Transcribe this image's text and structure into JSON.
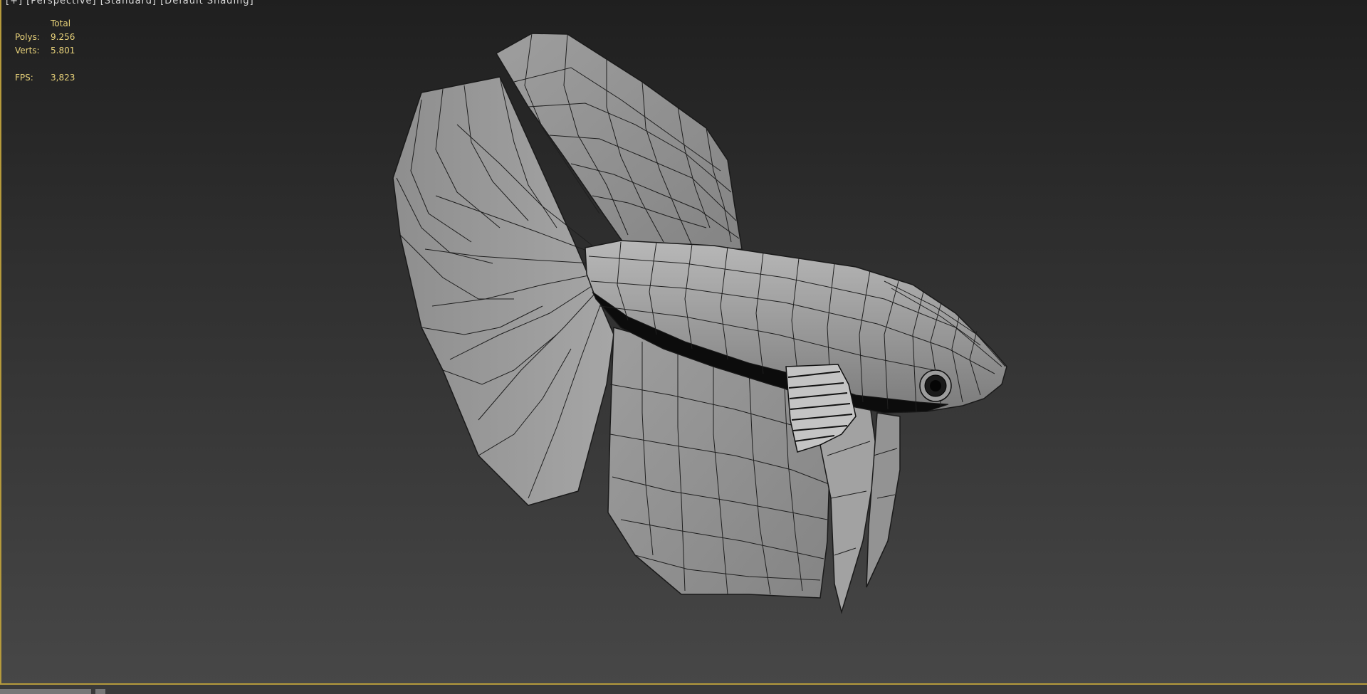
{
  "viewport": {
    "label": "[+] [Perspective] [Standard] [Default Shading]"
  },
  "stats": {
    "header": "Total",
    "polys_label": "Polys:",
    "polys_value": "9.256",
    "verts_label": "Verts:",
    "verts_value": "5.801",
    "fps_label": "FPS:",
    "fps_value": "3,823"
  },
  "colors": {
    "stats_text": "#e8d27a",
    "viewport_border": "#b59a3c"
  }
}
